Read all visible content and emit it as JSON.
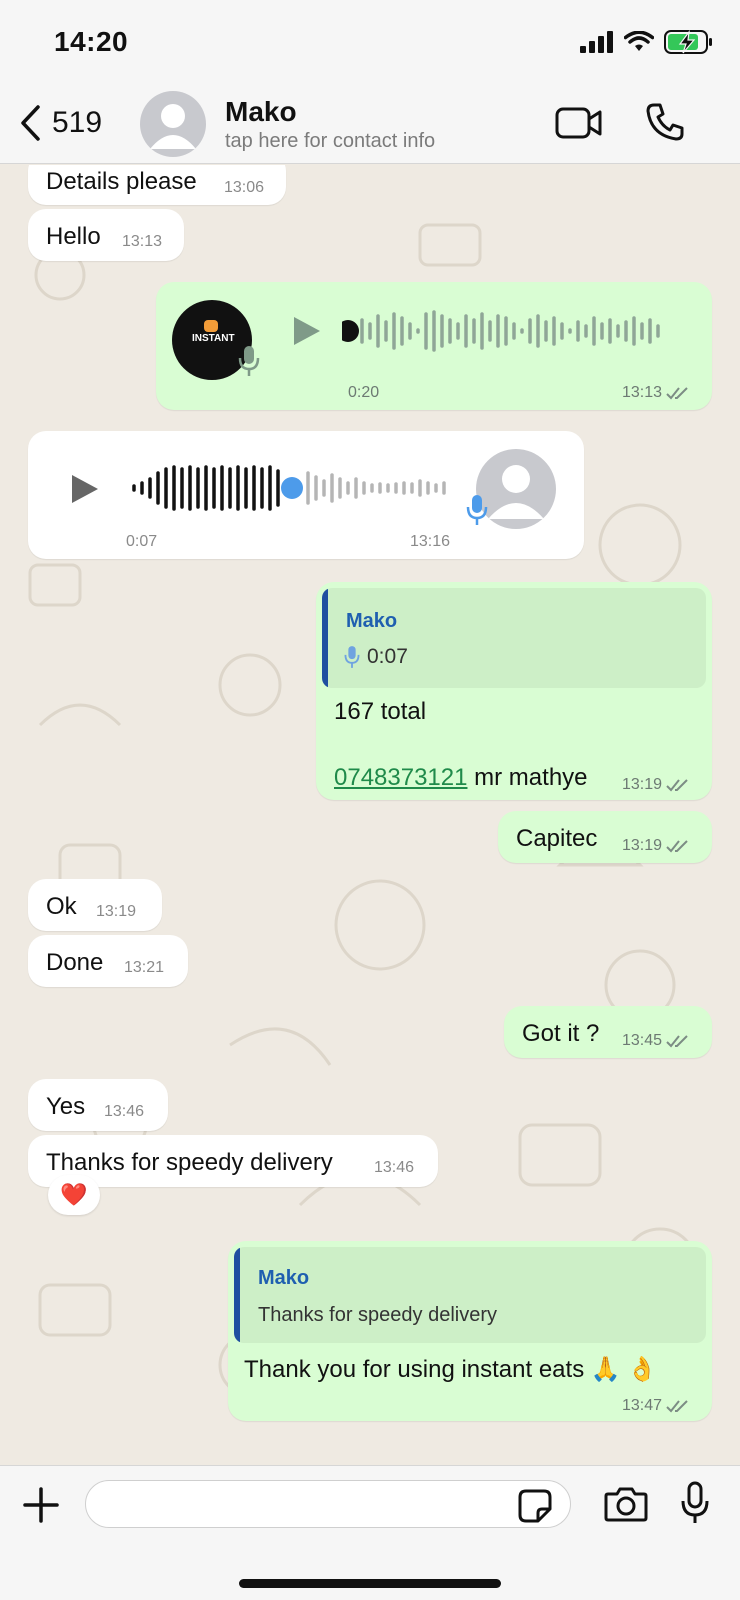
{
  "status_bar": {
    "time": "14:20"
  },
  "header": {
    "back_count": "519",
    "contact_name": "Mako",
    "contact_subtitle": "tap here for contact info"
  },
  "messages": [
    {
      "dir": "in",
      "text": "Details please",
      "time": "13:06"
    },
    {
      "dir": "in",
      "text": "Hello",
      "time": "13:13"
    },
    {
      "dir": "out",
      "type": "voice",
      "duration": "0:20",
      "time": "13:13",
      "avatar_logo_text": "INSTANT"
    },
    {
      "dir": "in",
      "type": "voice",
      "duration": "0:07",
      "time": "13:16",
      "progress": 0.55
    },
    {
      "dir": "out",
      "quote_name": "Mako",
      "quote_text": "0:07",
      "line1": "167 total",
      "phone": "0748373121",
      "line2": " mr mathye",
      "time": "13:19"
    },
    {
      "dir": "out",
      "text": "Capitec",
      "time": "13:19"
    },
    {
      "dir": "in",
      "text": "Ok",
      "time": "13:19"
    },
    {
      "dir": "in",
      "text": "Done",
      "time": "13:21"
    },
    {
      "dir": "out",
      "text": "Got it ?",
      "time": "13:45"
    },
    {
      "dir": "in",
      "text": "Yes",
      "time": "13:46"
    },
    {
      "dir": "in",
      "text": "Thanks for speedy delivery",
      "time": "13:46",
      "reaction": "❤️"
    },
    {
      "dir": "out",
      "quote_name": "Mako",
      "quote_text": "Thanks for speedy delivery",
      "text": "Thank you for using instant eats 🙏 👌",
      "time": "13:47"
    }
  ],
  "colors": {
    "outgoing_bubble": "#d9fdd3",
    "incoming_bubble": "#ffffff",
    "chat_background": "#efeae2",
    "read_ticks": "#8a9a92",
    "link": "#1f8a4a",
    "quote_name": "#1f5fb0"
  },
  "icons": [
    "back-chevron-icon",
    "avatar-icon",
    "video-call-icon",
    "phone-call-icon",
    "play-icon",
    "mic-icon",
    "plus-icon",
    "sticker-icon",
    "camera-icon",
    "microphone-icon",
    "signal-icon",
    "wifi-icon",
    "battery-charging-icon",
    "read-ticks-icon"
  ]
}
